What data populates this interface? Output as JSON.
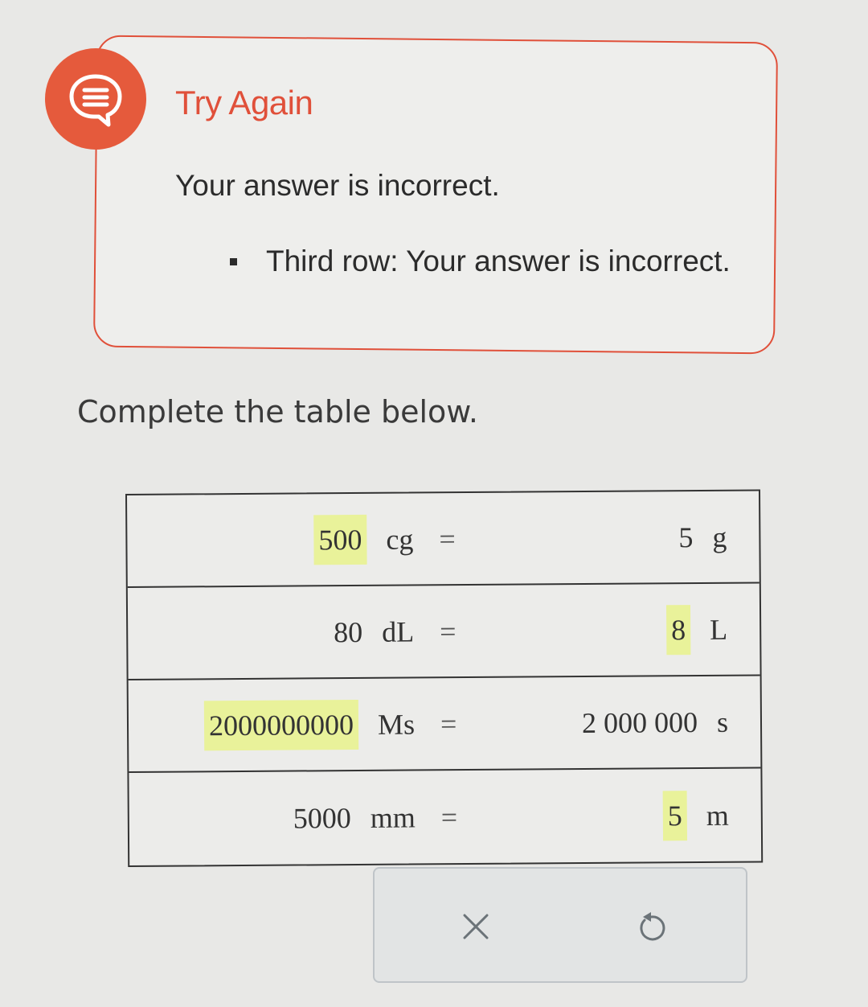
{
  "feedback": {
    "title": "Try Again",
    "message": "Your answer is incorrect.",
    "items": [
      "Third row: Your answer is incorrect."
    ]
  },
  "prompt": "Complete the table below.",
  "table": {
    "rows": [
      {
        "left_value": "500",
        "left_unit": "cg",
        "equals": "=",
        "right_value": "5",
        "right_unit": "g"
      },
      {
        "left_value": "80",
        "left_unit": "dL",
        "equals": "=",
        "right_value": "8",
        "right_unit": "L"
      },
      {
        "left_value": "2000000000",
        "left_unit": "Ms",
        "equals": "=",
        "right_value": "2 000 000",
        "right_unit": "s"
      },
      {
        "left_value": "5000",
        "left_unit": "mm",
        "equals": "=",
        "right_value": "5",
        "right_unit": "m"
      }
    ]
  },
  "actions": {
    "clear_icon": "close-icon",
    "undo_icon": "undo-icon"
  },
  "colors": {
    "accent": "#e55a3c",
    "highlight": "#e9f29a"
  }
}
